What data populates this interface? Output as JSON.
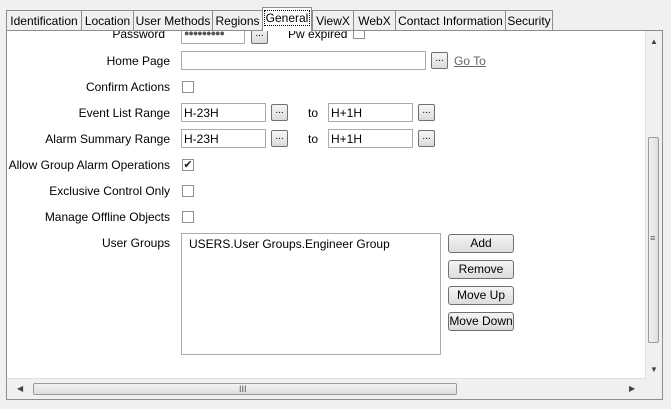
{
  "tabs": [
    "Identification",
    "Location",
    "User Methods",
    "Regions",
    "General",
    "ViewX",
    "WebX",
    "Contact Information",
    "Security"
  ],
  "active_tab": "General",
  "form": {
    "password_label": "Password",
    "password_value": "●●●●●●●●●",
    "pw_expired_label": "Pw expired",
    "home_page_label": "Home Page",
    "home_page_value": "",
    "go_to_link": "Go To",
    "confirm_actions_label": "Confirm Actions",
    "confirm_actions_checked": false,
    "event_list_range_label": "Event List Range",
    "event_list_from": "H-23H",
    "event_list_to": "H+1H",
    "alarm_summary_range_label": "Alarm Summary Range",
    "alarm_summary_from": "H-23H",
    "alarm_summary_to": "H+1H",
    "to_label": "to",
    "allow_group_alarm_label": "Allow Group Alarm Operations",
    "allow_group_alarm_checked": true,
    "exclusive_control_label": "Exclusive Control Only",
    "exclusive_control_checked": false,
    "manage_offline_label": "Manage Offline Objects",
    "manage_offline_checked": false,
    "user_groups_label": "User Groups",
    "user_groups": [
      "USERS.User Groups.Engineer Group"
    ],
    "ellipsis": "..."
  },
  "buttons": {
    "add": "Add",
    "remove": "Remove",
    "move_up": "Move Up",
    "move_down": "Move Down"
  },
  "icons": {
    "check": "✔",
    "arrow_up": "▲",
    "arrow_down": "▼",
    "arrow_left": "◀",
    "arrow_right": "▶",
    "grip_h": "III",
    "grip_v": "≡"
  }
}
